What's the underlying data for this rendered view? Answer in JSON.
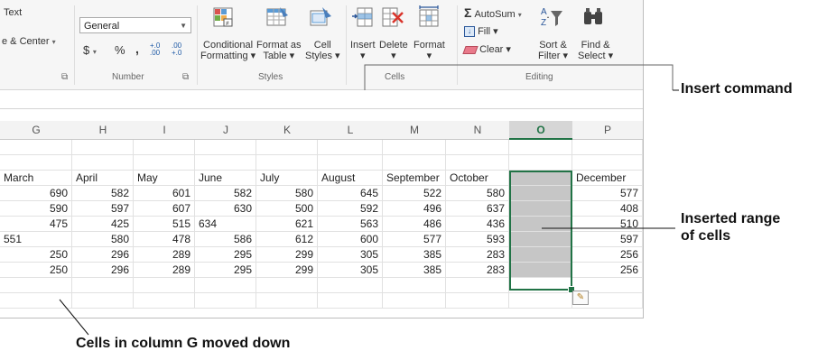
{
  "ribbon": {
    "wrap_text": "Text",
    "merge_center": "e & Center",
    "number_format": "General",
    "currency": "$",
    "percent": "%",
    "comma": ",",
    "inc_decimal": "+.0 .00",
    "dec_decimal": ".00 +.0",
    "group_number": "Number",
    "conditional_formatting": [
      "Conditional",
      "Formatting"
    ],
    "format_as_table": [
      "Format as",
      "Table"
    ],
    "cell_styles": [
      "Cell",
      "Styles"
    ],
    "group_styles": "Styles",
    "insert": "Insert",
    "delete": "Delete",
    "format": "Format",
    "group_cells": "Cells",
    "autosum": "AutoSum",
    "fill": "Fill",
    "clear": "Clear",
    "sort_filter": [
      "Sort &",
      "Filter"
    ],
    "find_select": [
      "Find &",
      "Select"
    ],
    "group_editing": "Editing"
  },
  "columns": [
    "G",
    "H",
    "I",
    "J",
    "K",
    "L",
    "M",
    "N",
    "O",
    "P"
  ],
  "selected_column": "O",
  "header_row": [
    "March",
    "April",
    "May",
    "June",
    "July",
    "August",
    "September",
    "October",
    "",
    "December"
  ],
  "rows": [
    [
      "690",
      "582",
      "601",
      "582",
      "580",
      "645",
      "522",
      "580",
      "",
      "577"
    ],
    [
      "590",
      "597",
      "607",
      "630",
      "500",
      "592",
      "496",
      "637",
      "",
      "408"
    ],
    [
      "475",
      "425",
      "515",
      "634",
      "621",
      "563",
      "486",
      "436",
      "",
      "510"
    ],
    [
      "551",
      "580",
      "478",
      "586",
      "612",
      "600",
      "577",
      "593",
      "",
      "597"
    ],
    [
      "250",
      "296",
      "289",
      "295",
      "299",
      "305",
      "385",
      "283",
      "",
      "256"
    ],
    [
      "250",
      "296",
      "289",
      "295",
      "299",
      "305",
      "385",
      "283",
      "",
      "256"
    ]
  ],
  "callouts": {
    "insert_command": "Insert command",
    "inserted_range": [
      "Inserted range",
      "of cells"
    ],
    "cells_moved": "Cells in column G moved down"
  },
  "colors": {
    "accent": "#217346",
    "inserted": "#c6c6c6"
  }
}
